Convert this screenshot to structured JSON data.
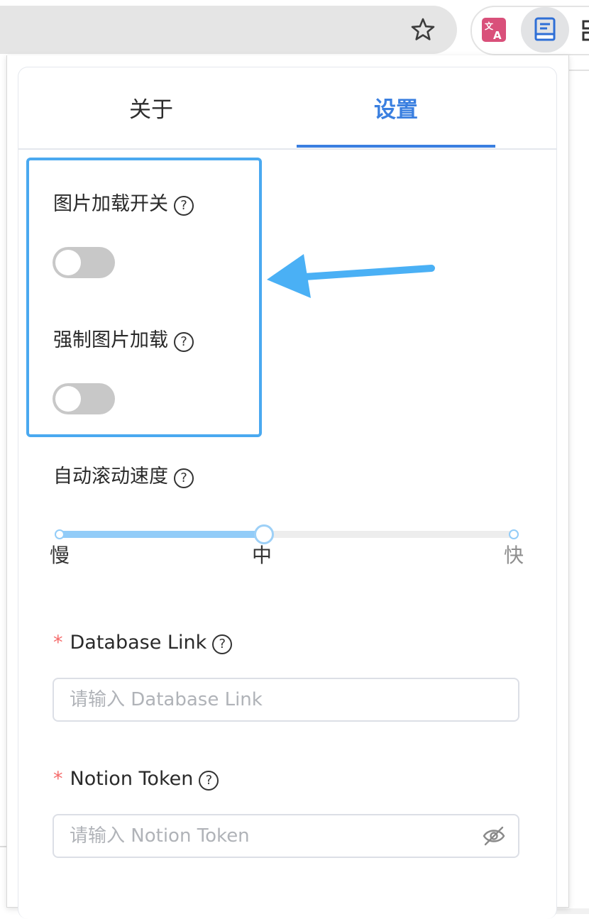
{
  "tabs": [
    {
      "label": "关于",
      "active": false
    },
    {
      "label": "设置",
      "active": true
    }
  ],
  "settings": {
    "image_loading": {
      "label": "图片加载开关",
      "help": "?",
      "enabled": false
    },
    "force_image_loading": {
      "label": "强制图片加载",
      "help": "?",
      "enabled": false
    },
    "scroll_speed": {
      "label": "自动滚动速度",
      "help": "?",
      "marks": [
        "慢",
        "中",
        "快"
      ],
      "value_fraction": 0.45
    },
    "database_link": {
      "required_mark": "*",
      "label": "Database Link",
      "help": "?",
      "placeholder": "请输入 Database Link",
      "value": ""
    },
    "notion_token": {
      "required_mark": "*",
      "label": "Notion Token",
      "help": "?",
      "placeholder": "请输入 Notion Token",
      "value": ""
    }
  },
  "icons": {
    "bookmark": "star-icon",
    "translate_extension": "translate-icon",
    "active_extension": "book-icon",
    "password_toggle": "eye-off-icon"
  },
  "colors": {
    "accent": "#3a7fe0",
    "highlight": "#4aa9f0",
    "required": "#f56c6c"
  }
}
